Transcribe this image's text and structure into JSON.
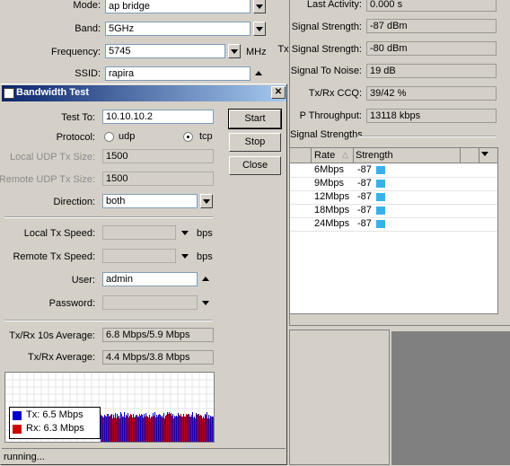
{
  "bg_form": {
    "mode_label": "Mode:",
    "mode_value": "ap bridge",
    "band_label": "Band:",
    "band_value": "5GHz",
    "frequency_label": "Frequency:",
    "frequency_value": "5745",
    "frequency_unit": "MHz",
    "ssid_label": "SSID:",
    "ssid_value": "rapira"
  },
  "status_panel": {
    "last_activity_label": "Last Activity:",
    "last_activity_value": "0.000 s",
    "signal_strength_label": "Signal Strength:",
    "signal_strength_value": "-87 dBm",
    "tx_signal_strength_label": "Tx Signal Strength:",
    "tx_signal_strength_value": "-80 dBm",
    "signal_to_noise_label": "Signal To Noise:",
    "signal_to_noise_value": "19 dB",
    "ccq_label": "Tx/Rx CCQ:",
    "ccq_value": "39/42 %",
    "p_throughput_label": "P Throughput:",
    "p_throughput_value": "13118 kbps",
    "signal_strengths_title": "Signal Strengths",
    "columns": {
      "rate": "Rate",
      "strength": "Strength"
    },
    "rows": [
      {
        "rate": "6Mbps",
        "strength": "-87"
      },
      {
        "rate": "9Mbps",
        "strength": "-87"
      },
      {
        "rate": "12Mbps",
        "strength": "-87"
      },
      {
        "rate": "18Mbps",
        "strength": "-87"
      },
      {
        "rate": "24Mbps",
        "strength": "-87"
      }
    ]
  },
  "dialog": {
    "title": "Bandwidth Test",
    "close_glyph": "✕",
    "test_to_label": "Test To:",
    "test_to_value": "10.10.10.2",
    "protocol_label": "Protocol:",
    "protocol_udp": "udp",
    "protocol_tcp": "tcp",
    "local_udp_label": "Local UDP Tx Size:",
    "local_udp_value": "1500",
    "remote_udp_label": "Remote UDP Tx Size:",
    "remote_udp_value": "1500",
    "direction_label": "Direction:",
    "direction_value": "both",
    "local_tx_label": "Local Tx Speed:",
    "local_tx_unit": "bps",
    "remote_tx_label": "Remote Tx Speed:",
    "remote_tx_unit": "bps",
    "user_label": "User:",
    "user_value": "admin",
    "password_label": "Password:",
    "avg10_label": "Tx/Rx 10s Average:",
    "avg10_value": "6.8 Mbps/5.9 Mbps",
    "avg_label": "Tx/Rx Average:",
    "avg_value": "4.4 Mbps/3.8 Mbps",
    "start_label": "Start",
    "stop_label": "Stop",
    "close_label": "Close",
    "legend_tx": "Tx:  6.5 Mbps",
    "legend_rx": "Rx:  6.3 Mbps",
    "tx_color": "#0000cc",
    "rx_color": "#cc0000",
    "status_text": "running..."
  }
}
